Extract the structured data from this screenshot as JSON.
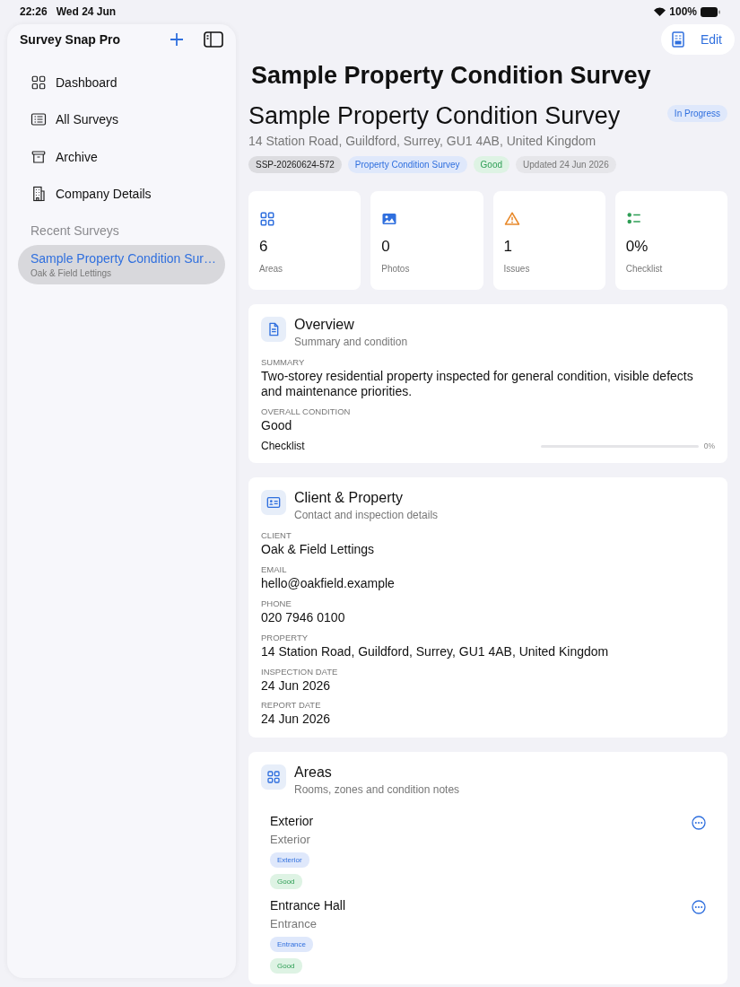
{
  "status_bar": {
    "time": "22:26",
    "date": "Wed 24 Jun",
    "battery": "100%"
  },
  "sidebar": {
    "title": "Survey Snap Pro",
    "items": [
      {
        "label": "Dashboard",
        "selected": false
      },
      {
        "label": "All Surveys",
        "selected": false
      },
      {
        "label": "Archive",
        "selected": false
      },
      {
        "label": "Company Details",
        "selected": false
      }
    ],
    "recent_heading": "Recent Surveys",
    "recent": [
      {
        "title": "Sample Property Condition Sur…",
        "client": "Oak & Field Lettings",
        "selected": true
      }
    ]
  },
  "toolbar": {
    "edit": "Edit"
  },
  "nav_title": "Sample Property Condition Survey",
  "header": {
    "title": "Sample Property Condition Survey",
    "status": "In Progress",
    "address": "14 Station Road, Guildford, Surrey, GU1 4AB, United Kingdom",
    "chips": [
      {
        "label": "SSP-20260624-572",
        "kind": "id"
      },
      {
        "label": "Property Condition Survey",
        "kind": "type"
      },
      {
        "label": "Good",
        "kind": "condition"
      },
      {
        "label": "Updated 24 Jun 2026",
        "kind": "date"
      }
    ]
  },
  "stats": [
    {
      "value": "6",
      "label": "Areas"
    },
    {
      "value": "0",
      "label": "Photos"
    },
    {
      "value": "1",
      "label": "Issues"
    },
    {
      "value": "0%",
      "label": "Checklist"
    }
  ],
  "overview": {
    "title": "Overview",
    "subtitle": "Summary and condition",
    "fields": [
      {
        "label": "SUMMARY",
        "value": "Two-storey residential property inspected for general condition, visible defects and maintenance priorities."
      },
      {
        "label": "OVERALL CONDITION",
        "value": "Good"
      }
    ],
    "checklist": {
      "label": "Checklist",
      "level": 0,
      "reading": "0%"
    }
  },
  "client": {
    "title": "Client & Property",
    "subtitle": "Contact and inspection details",
    "fields": [
      {
        "label": "CLIENT",
        "value": "Oak & Field Lettings"
      },
      {
        "label": "EMAIL",
        "value": "hello@oakfield.example"
      },
      {
        "label": "PHONE",
        "value": "020 7946 0100"
      },
      {
        "label": "PROPERTY",
        "value": "14 Station Road, Guildford, Surrey, GU1 4AB, United Kingdom"
      },
      {
        "label": "INSPECTION DATE",
        "value": "24 Jun 2026"
      },
      {
        "label": "REPORT DATE",
        "value": "24 Jun 2026"
      }
    ]
  },
  "areas": {
    "title": "Areas",
    "subtitle": "Rooms, zones and condition notes",
    "items": [
      {
        "name": "Exterior",
        "type": "Exterior",
        "tags": [
          {
            "label": "Exterior",
            "kind": "type"
          },
          {
            "label": "Good",
            "kind": "condition"
          }
        ]
      },
      {
        "name": "Entrance Hall",
        "type": "Entrance",
        "tags": [
          {
            "label": "Entrance",
            "kind": "type"
          },
          {
            "label": "Good",
            "kind": "condition"
          }
        ]
      }
    ]
  }
}
